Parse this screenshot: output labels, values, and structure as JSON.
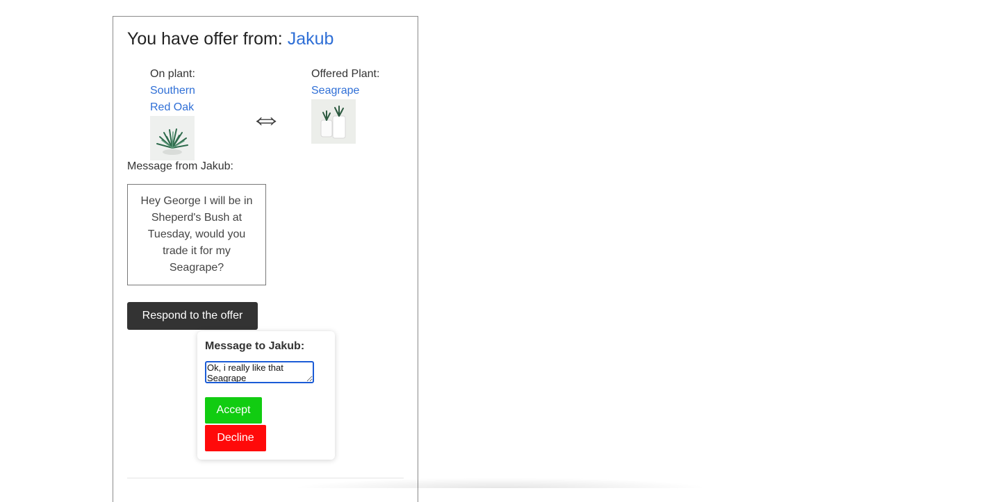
{
  "offer": {
    "title_prefix": "You have offer from:",
    "sender": "Jakub",
    "on_plant_label": "On plant:",
    "on_plant_name": "Southern Red Oak",
    "offered_plant_label": "Offered Plant:",
    "offered_plant_name": "Seagrape",
    "swap_icon": "double-arrow-icon",
    "message_label": "Message from Jakub:",
    "message_text": "Hey George I will be in Sheperd's Bush at Tuesday, would you trade it for my Seagrape?",
    "respond_label": "Respond to the offer"
  },
  "response": {
    "title": "Message to Jakub:",
    "reply_value": "Ok, i really like that Seagrape",
    "accept_label": "Accept",
    "decline_label": "Decline"
  },
  "colors": {
    "link": "#2f6fd6",
    "respond_button": "#333333",
    "accept": "#11cc11",
    "decline": "#ff0a0a"
  }
}
